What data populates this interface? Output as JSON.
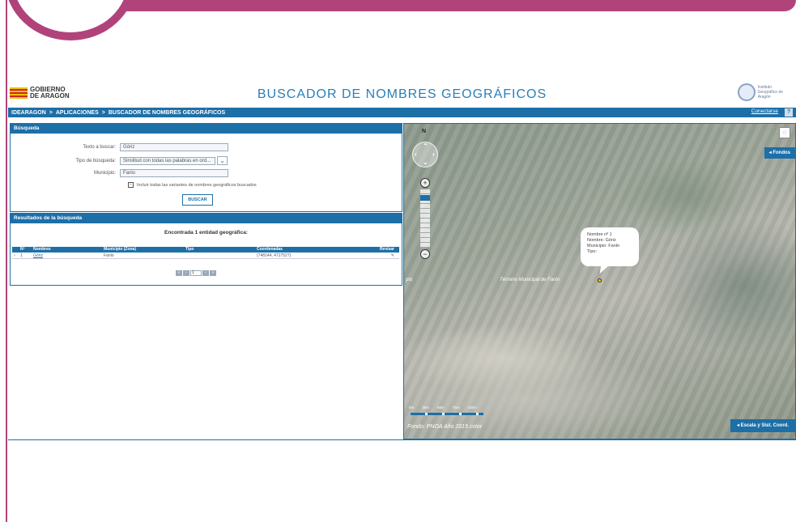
{
  "header": {
    "logo_line1": "GOBIERNO",
    "logo_line2": "DE ARAGON",
    "title": "BUSCADOR DE NOMBRES GEOGRÁFICOS",
    "ign_line1": "Instituto",
    "ign_line2": "Geográfico de",
    "ign_line3": "Aragón"
  },
  "breadcrumb": {
    "items": [
      "IDEARAGON",
      ">",
      "APLICACIONES",
      ">",
      "BUSCADOR DE NOMBRES GEOGRÁFICOS"
    ],
    "connect": "Conectarse",
    "help": "?"
  },
  "search": {
    "panel_title": "Búsqueda",
    "text_label": "Texto a buscar:",
    "text_value": "Góriz",
    "type_label": "Tipo de búsqueda:",
    "type_value": "Similitud con todas las palabras en ord...",
    "municipio_label": "Municipio:",
    "municipio_value": "Fanlo",
    "checkbox_label": "Incluir todas las variantes de nombres geográficos buscados",
    "button_label": "BUSCAR"
  },
  "results": {
    "panel_title": "Resultados de la búsqueda",
    "found_text": "Encontrada 1 entidad geográfica:",
    "columns": [
      "",
      "Nº",
      "Nombres",
      "Municipio (Zona)",
      "Tipo",
      "Coordenadas",
      "Revisar"
    ],
    "rows": [
      {
        "num": "1",
        "name": "Góriz",
        "municipio": "Fanlo",
        "tipo": "",
        "coords": "(748144, 4727527)"
      }
    ],
    "pager": {
      "first": "«",
      "prev": "‹",
      "page": "1",
      "next": "›",
      "last": "»"
    }
  },
  "map": {
    "north": "N",
    "fondos_label": "◂ Fondos",
    "popup": {
      "line1": "Nombre nº 1",
      "line2": "Nombre: Góriz",
      "line3": "Municipio: Fanlo",
      "line4": "Tipo:"
    },
    "toponym": "Término Municipal de Fanlo",
    "toponym_left": "pto",
    "scale_labels": [
      "0m",
      "25m",
      "50m",
      "75m",
      "100m"
    ],
    "fondo_text": "Fondo: PNOA Año 2015 color",
    "escala_label": "◂ Escala y Sist. Coord.",
    "zoom_level_fraction": 0.1
  }
}
